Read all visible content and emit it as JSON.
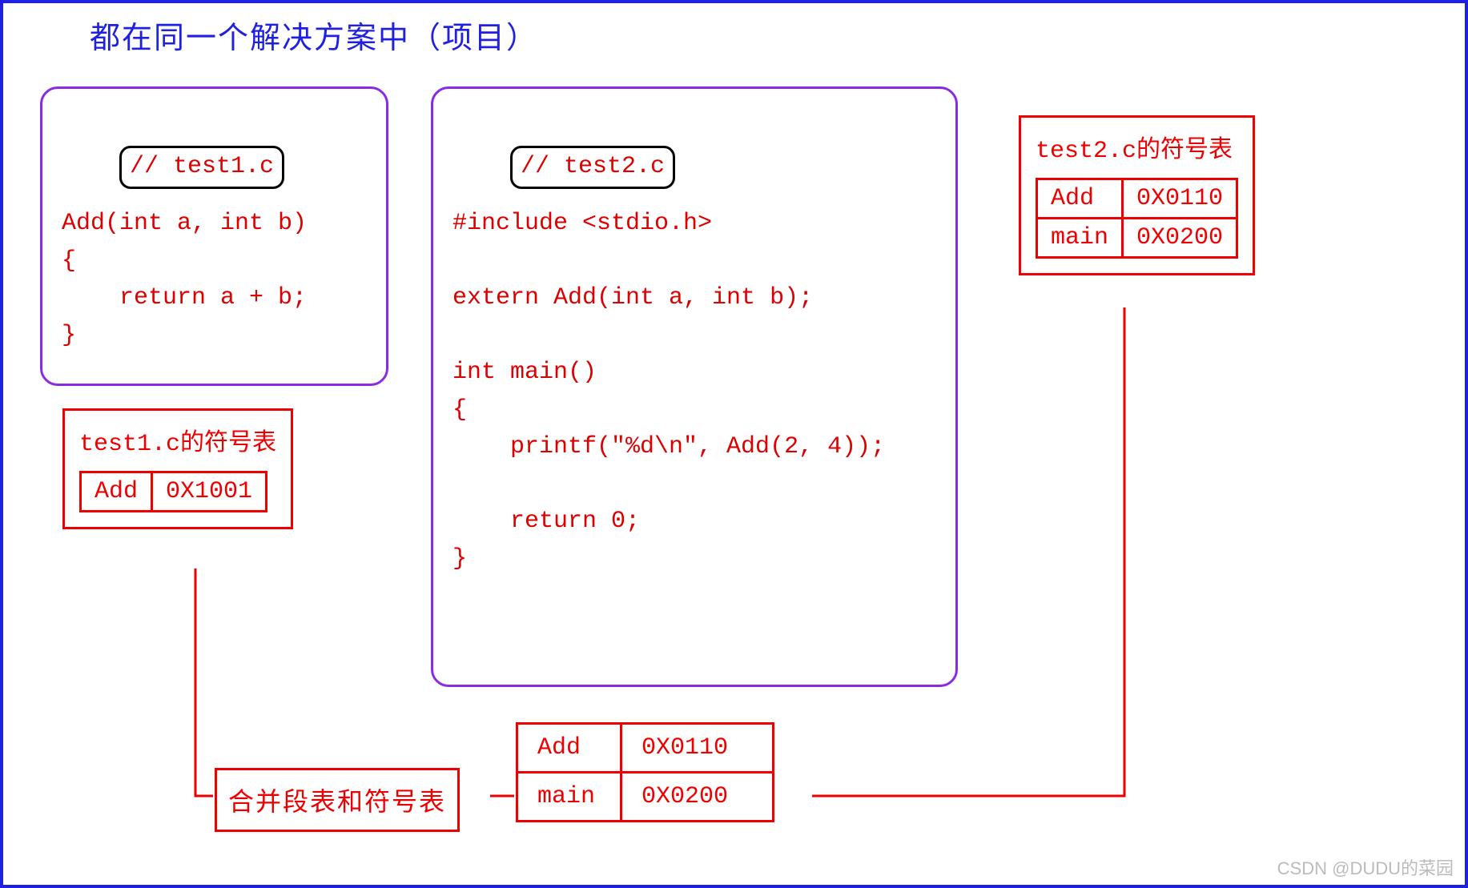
{
  "title": "都在同一个解决方案中（项目）",
  "panel1": {
    "filename": "// test1.c",
    "code": "Add(int a, int b)\n{\n    return a + b;\n}"
  },
  "panel2": {
    "filename": "// test2.c",
    "code": "#include <stdio.h>\n\nextern Add(int a, int b);\n\nint main()\n{\n    printf(\"%d\\n\", Add(2, 4));\n\n    return 0;\n}"
  },
  "sym1": {
    "title": "test1.c的符号表",
    "rows": [
      {
        "name": "Add",
        "addr": "0X1001"
      }
    ]
  },
  "sym2": {
    "title": "test2.c的符号表",
    "rows": [
      {
        "name": "Add",
        "addr": "0X0110"
      },
      {
        "name": "main",
        "addr": "0X0200"
      }
    ]
  },
  "merge": {
    "label": "合并段表和符号表",
    "rows": [
      {
        "name": "Add",
        "addr": "0X0110"
      },
      {
        "name": "main",
        "addr": "0X0200"
      }
    ]
  },
  "watermark": "CSDN @DUDU的菜园"
}
